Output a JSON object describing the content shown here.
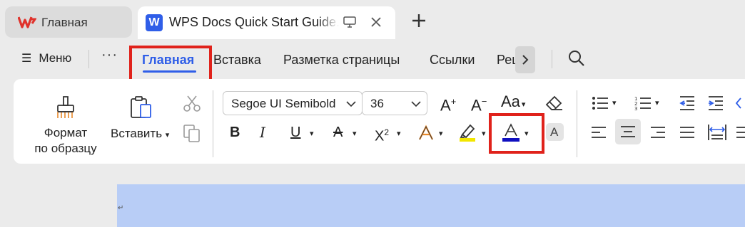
{
  "tabs": {
    "home_label": "Главная",
    "doc_label": "WPS Docs Quick Start Guide.docx"
  },
  "menu": {
    "menu_label": "Меню",
    "more_label": "···",
    "items": [
      "Главная",
      "Вставка",
      "Разметка страницы",
      "Ссылки",
      "Рец"
    ]
  },
  "ribbon": {
    "format_painter_line1": "Формат",
    "format_painter_line2": "по образцу",
    "paste_label": "Вставить",
    "font_name": "Segoe UI Semibold",
    "font_size": "36"
  },
  "colors": {
    "accent": "#2f5ee8",
    "highlight_red": "#e0221b",
    "font_color_bar": "#1010c0",
    "highlighter_bar": "#f2e600",
    "document_bg": "#b8cdf6"
  }
}
